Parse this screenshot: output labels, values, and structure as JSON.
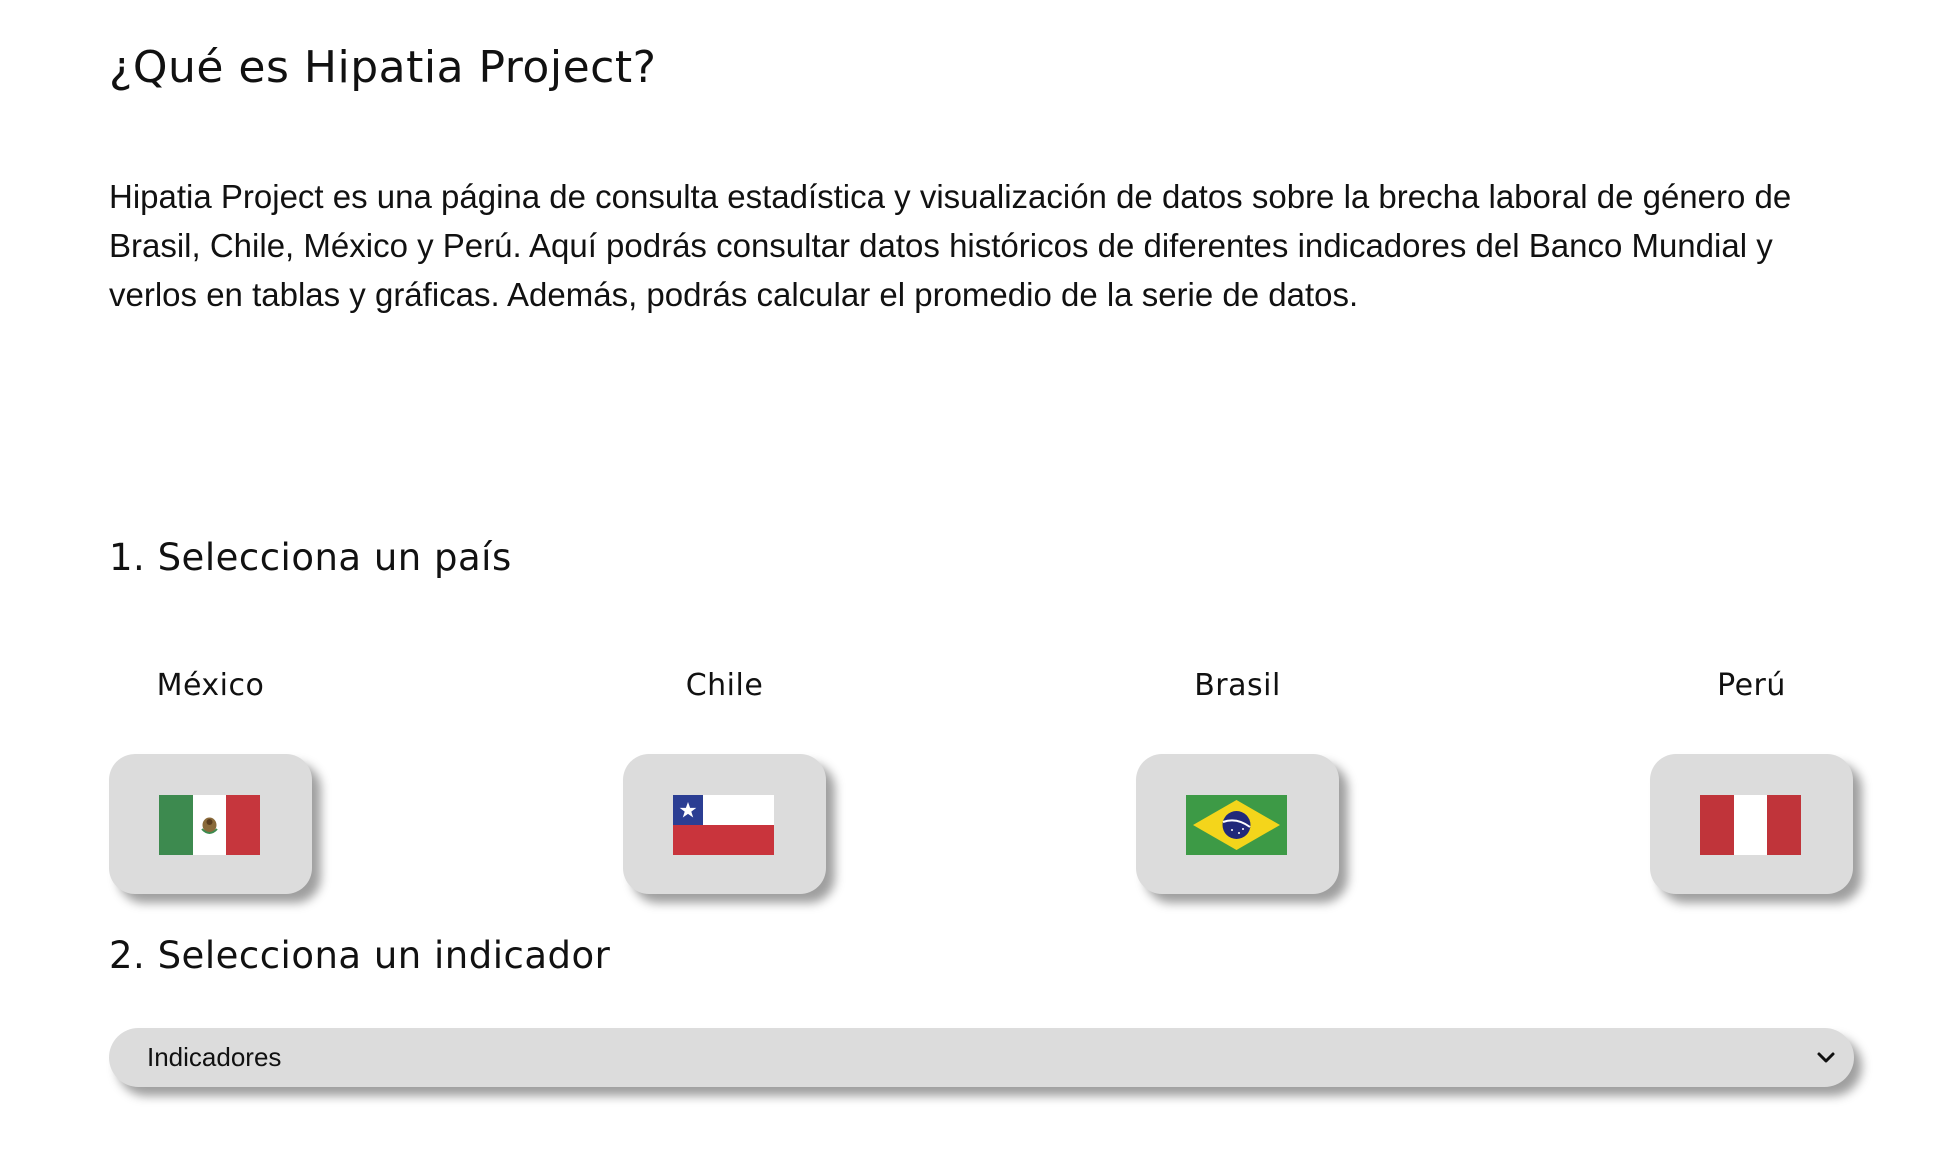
{
  "intro": {
    "title": "¿Qué es Hipatia Project?",
    "description": "Hipatia Project es una página de consulta estadística y visualización de datos sobre la brecha laboral de género de Brasil, Chile, México y Perú. Aquí podrás consultar datos históricos de diferentes indicadores del Banco Mundial y verlos en tablas y gráficas. Además, podrás calcular el promedio de la serie de datos."
  },
  "step1": {
    "heading": "1. Selecciona un país",
    "countries": [
      {
        "name": "México",
        "flag_icon": "mexico-flag-icon"
      },
      {
        "name": "Chile",
        "flag_icon": "chile-flag-icon"
      },
      {
        "name": "Brasil",
        "flag_icon": "brazil-flag-icon"
      },
      {
        "name": "Perú",
        "flag_icon": "peru-flag-icon"
      }
    ]
  },
  "step2": {
    "heading": "2. Selecciona un indicador",
    "select_value": "Indicadores"
  },
  "colors": {
    "button_bg": "#dcdcdc",
    "text": "#111111",
    "mexico_green": "#3d8a4f",
    "mexico_red": "#c6363d",
    "chile_blue": "#2b3e93",
    "chile_red": "#c9343c",
    "brazil_green": "#3d9a46",
    "brazil_yellow": "#f4d51b",
    "brazil_blue": "#21297a",
    "peru_red": "#c0343a"
  }
}
